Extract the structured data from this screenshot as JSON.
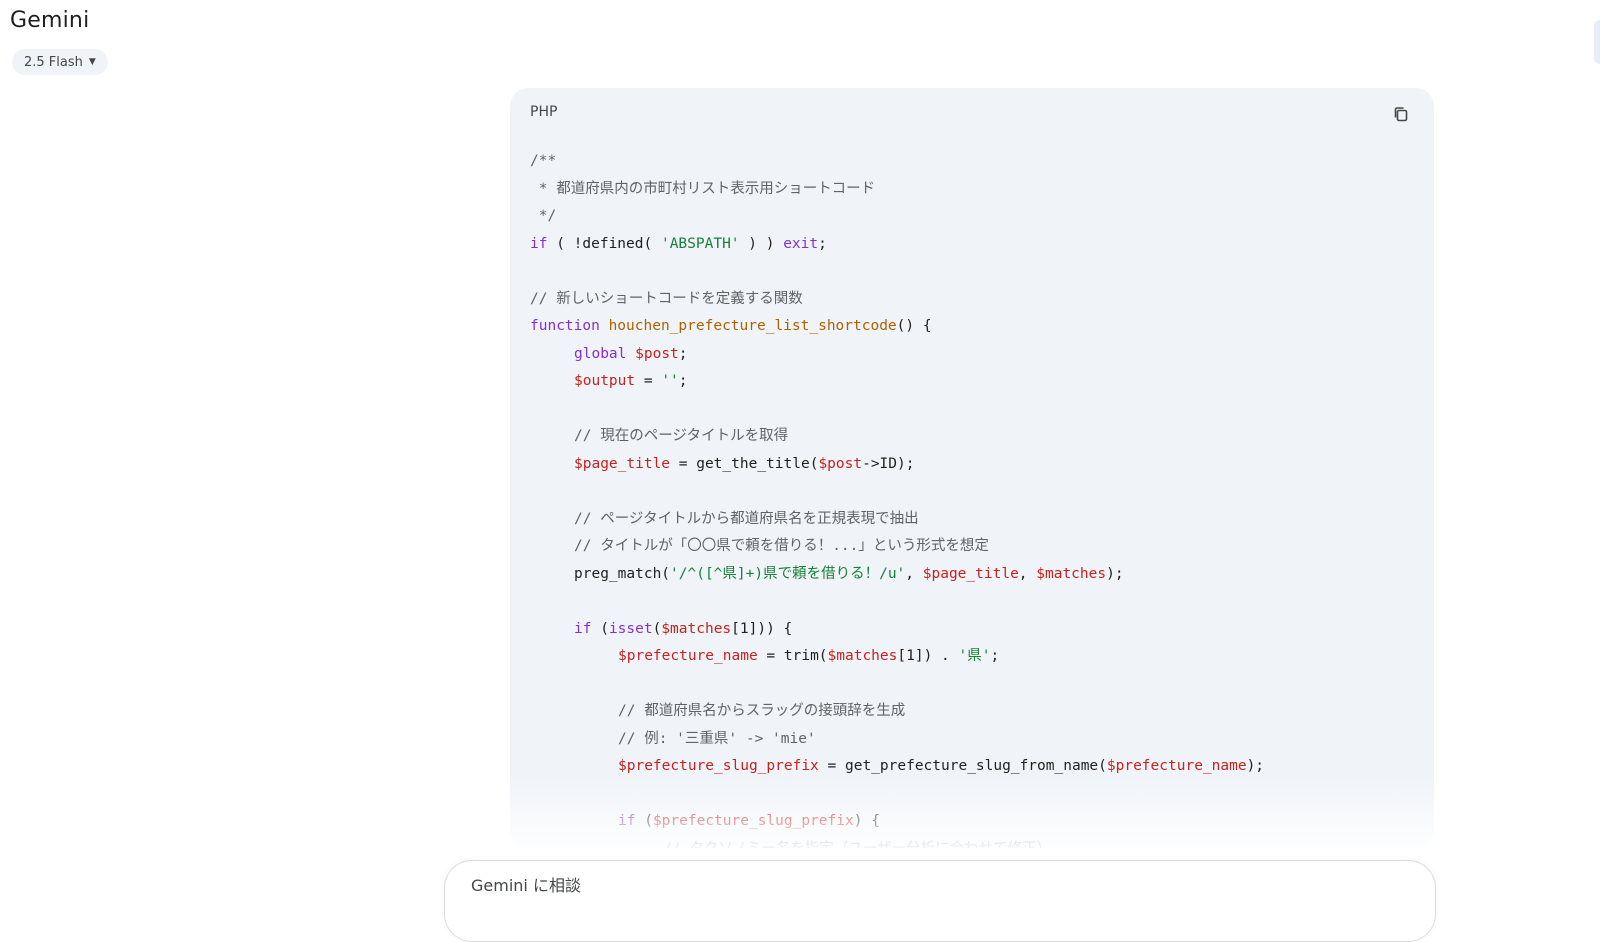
{
  "app": {
    "title": "Gemini"
  },
  "model_selector": {
    "label": "2.5 Flash"
  },
  "code_block": {
    "language": "PHP",
    "copy_icon": "copy-icon",
    "lines": [
      {
        "indent": 0,
        "tokens": [
          {
            "c": "cmt",
            "t": "/**"
          }
        ]
      },
      {
        "indent": 0,
        "tokens": [
          {
            "c": "cmt",
            "t": " * 都道府県内の市町村リスト表示用ショートコード"
          }
        ]
      },
      {
        "indent": 0,
        "tokens": [
          {
            "c": "cmt",
            "t": " */"
          }
        ]
      },
      {
        "indent": 0,
        "tokens": [
          {
            "c": "kw",
            "t": "if"
          },
          {
            "c": "",
            "t": " ( !defined( "
          },
          {
            "c": "str",
            "t": "'ABSPATH'"
          },
          {
            "c": "",
            "t": " ) ) "
          },
          {
            "c": "kw",
            "t": "exit"
          },
          {
            "c": "",
            "t": ";"
          }
        ]
      },
      {
        "indent": 0,
        "tokens": []
      },
      {
        "indent": 0,
        "tokens": [
          {
            "c": "cmt",
            "t": "// 新しいショートコードを定義する関数"
          }
        ]
      },
      {
        "indent": 0,
        "tokens": [
          {
            "c": "kw",
            "t": "function"
          },
          {
            "c": "",
            "t": " "
          },
          {
            "c": "fn",
            "t": "houchen_prefecture_list_shortcode"
          },
          {
            "c": "",
            "t": "() {"
          }
        ]
      },
      {
        "indent": 1,
        "tokens": [
          {
            "c": "kw",
            "t": "global"
          },
          {
            "c": "",
            "t": " "
          },
          {
            "c": "var",
            "t": "$post"
          },
          {
            "c": "",
            "t": ";"
          }
        ]
      },
      {
        "indent": 1,
        "tokens": [
          {
            "c": "var",
            "t": "$output"
          },
          {
            "c": "",
            "t": " = "
          },
          {
            "c": "str",
            "t": "''"
          },
          {
            "c": "",
            "t": ";"
          }
        ]
      },
      {
        "indent": 0,
        "tokens": []
      },
      {
        "indent": 1,
        "tokens": [
          {
            "c": "cmt",
            "t": "// 現在のページタイトルを取得"
          }
        ]
      },
      {
        "indent": 1,
        "tokens": [
          {
            "c": "var",
            "t": "$page_title"
          },
          {
            "c": "",
            "t": " = get_the_title("
          },
          {
            "c": "var",
            "t": "$post"
          },
          {
            "c": "",
            "t": "->ID);"
          }
        ]
      },
      {
        "indent": 0,
        "tokens": []
      },
      {
        "indent": 1,
        "tokens": [
          {
            "c": "cmt",
            "t": "// ページタイトルから都道府県名を正規表現で抽出"
          }
        ]
      },
      {
        "indent": 1,
        "tokens": [
          {
            "c": "cmt",
            "t": "// タイトルが「〇〇県で頼を借りる！...」という形式を想定"
          }
        ]
      },
      {
        "indent": 1,
        "tokens": [
          {
            "c": "",
            "t": "preg_match("
          },
          {
            "c": "str",
            "t": "'/^([^県]+)県で頼を借りる！/u'"
          },
          {
            "c": "",
            "t": ", "
          },
          {
            "c": "var",
            "t": "$page_title"
          },
          {
            "c": "",
            "t": ", "
          },
          {
            "c": "var",
            "t": "$matches"
          },
          {
            "c": "",
            "t": ");"
          }
        ]
      },
      {
        "indent": 0,
        "tokens": []
      },
      {
        "indent": 1,
        "tokens": [
          {
            "c": "kw",
            "t": "if"
          },
          {
            "c": "",
            "t": " ("
          },
          {
            "c": "kw",
            "t": "isset"
          },
          {
            "c": "",
            "t": "("
          },
          {
            "c": "var",
            "t": "$matches"
          },
          {
            "c": "",
            "t": "[1])) {"
          }
        ]
      },
      {
        "indent": 2,
        "tokens": [
          {
            "c": "var",
            "t": "$prefecture_name"
          },
          {
            "c": "",
            "t": " = trim("
          },
          {
            "c": "var",
            "t": "$matches"
          },
          {
            "c": "",
            "t": "[1]) . "
          },
          {
            "c": "str",
            "t": "'県'"
          },
          {
            "c": "",
            "t": ";"
          }
        ]
      },
      {
        "indent": 0,
        "tokens": []
      },
      {
        "indent": 2,
        "tokens": [
          {
            "c": "cmt",
            "t": "// 都道府県名からスラッグの接頭辞を生成"
          }
        ]
      },
      {
        "indent": 2,
        "tokens": [
          {
            "c": "cmt",
            "t": "// 例: '三重県' -> 'mie'"
          }
        ]
      },
      {
        "indent": 2,
        "tokens": [
          {
            "c": "var",
            "t": "$prefecture_slug_prefix"
          },
          {
            "c": "",
            "t": " = get_prefecture_slug_from_name("
          },
          {
            "c": "var",
            "t": "$prefecture_name"
          },
          {
            "c": "",
            "t": ");"
          }
        ]
      },
      {
        "indent": 0,
        "tokens": []
      },
      {
        "indent": 2,
        "tokens": [
          {
            "c": "kw",
            "t": "if"
          },
          {
            "c": "",
            "t": " ("
          },
          {
            "c": "var",
            "t": "$prefecture_slug_prefix"
          },
          {
            "c": "",
            "t": ") {"
          }
        ]
      },
      {
        "indent": 3,
        "tokens": [
          {
            "c": "cmt",
            "t": "// タクソノミー名を指定（ユーザー分析に合わせて修正）"
          }
        ]
      }
    ]
  },
  "prompt": {
    "placeholder": "Gemini に相談"
  }
}
